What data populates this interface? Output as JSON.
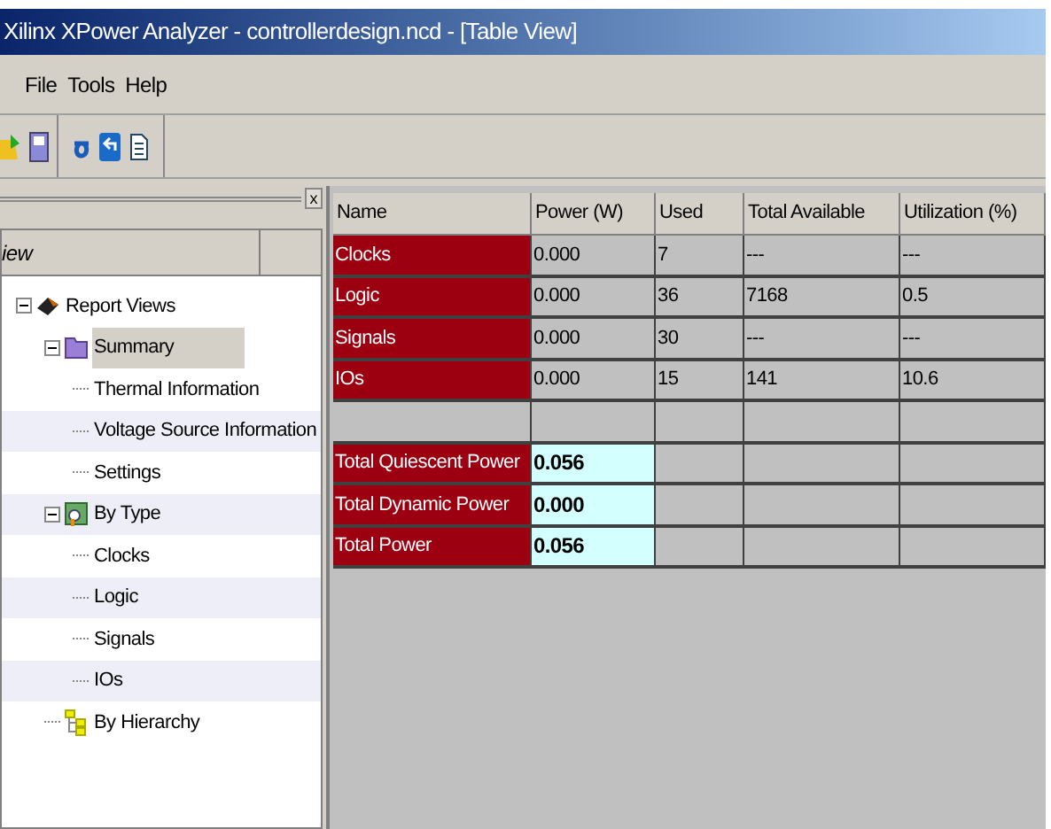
{
  "window": {
    "title": "Xilinx XPower Analyzer - controllerdesign.ncd - [Table View]"
  },
  "menu": [
    "File",
    "Tools",
    "Help"
  ],
  "panel": {
    "header": "iew",
    "close": "x"
  },
  "tree": [
    {
      "label": "Report Views",
      "kind": "chip",
      "expanded": true,
      "selected": false,
      "children": [
        {
          "label": "Summary",
          "kind": "folder",
          "expanded": true,
          "selected": true,
          "children": [
            {
              "label": "Thermal Information",
              "selected": false
            },
            {
              "label": "Voltage Source Information",
              "selected": false
            },
            {
              "label": "Settings",
              "selected": false
            }
          ]
        },
        {
          "label": "By Type",
          "kind": "chart",
          "expanded": true,
          "selected": false,
          "children": [
            {
              "label": "Clocks",
              "selected": false
            },
            {
              "label": "Logic",
              "selected": false
            },
            {
              "label": "Signals",
              "selected": false
            },
            {
              "label": "IOs",
              "selected": false
            }
          ]
        },
        {
          "label": "By Hierarchy",
          "kind": "hierarchy",
          "selected": false
        }
      ]
    }
  ],
  "table": {
    "columns": [
      "Name",
      "Power (W)",
      "Used",
      "Total Available",
      "Utilization (%)"
    ],
    "rows": [
      {
        "kind": "resource",
        "cells": [
          "Clocks",
          "0.000",
          "7",
          "---",
          "---"
        ]
      },
      {
        "kind": "resource",
        "cells": [
          "Logic",
          "0.000",
          "36",
          "7168",
          "0.5"
        ]
      },
      {
        "kind": "resource",
        "cells": [
          "Signals",
          "0.000",
          "30",
          "---",
          "---"
        ]
      },
      {
        "kind": "resource",
        "cells": [
          "IOs",
          "0.000",
          "15",
          "141",
          "10.6"
        ]
      },
      {
        "kind": "blank",
        "cells": []
      },
      {
        "kind": "total",
        "cells": [
          "Total Quiescent Power",
          "0.056"
        ]
      },
      {
        "kind": "total",
        "cells": [
          "Total Dynamic Power",
          "0.000"
        ]
      },
      {
        "kind": "total",
        "cells": [
          "Total Power",
          "0.056"
        ]
      }
    ]
  }
}
